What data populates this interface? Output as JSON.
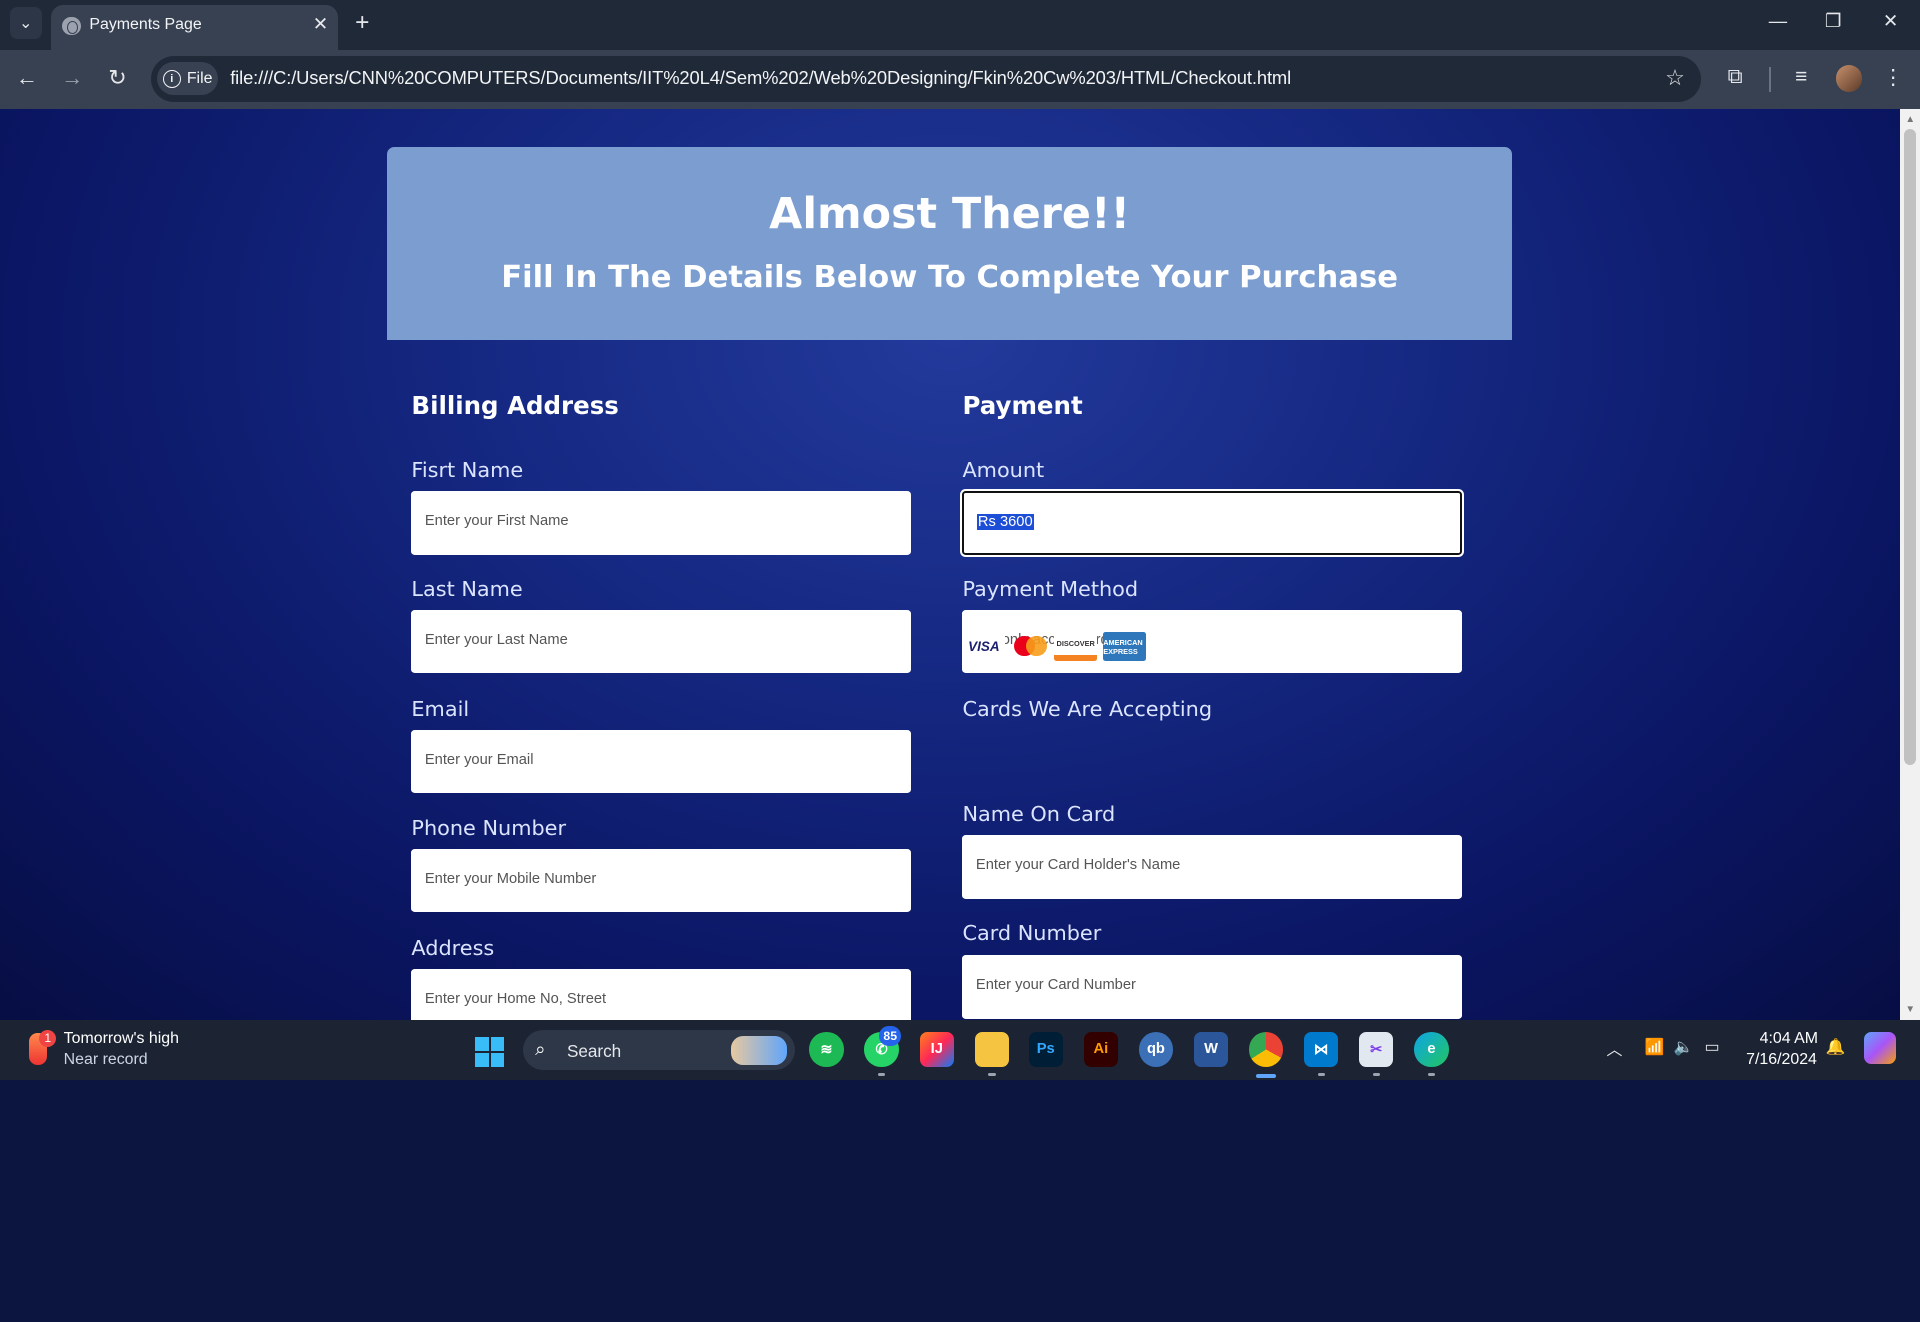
{
  "browser": {
    "tab_title": "Payments Page",
    "new_tab": "+",
    "close_tab": "✕",
    "site_chip": "File",
    "url": "file:///C:/Users/CNN%20COMPUTERS/Documents/IIT%20L4/Sem%202/Web%20Designing/Fkin%20Cw%203/HTML/Checkout.html"
  },
  "hero": {
    "title": "Almost There!!",
    "subtitle": "Fill In The Details Below To Complete Your Purchase"
  },
  "billing": {
    "title": "Billing Address",
    "first_name_label": "Fisrt Name",
    "first_name_placeholder": "Enter your First Name",
    "last_name_label": "Last Name",
    "last_name_placeholder": "Enter your Last Name",
    "email_label": "Email",
    "email_placeholder": "Enter your Email",
    "phone_label": "Phone Number",
    "phone_placeholder": "Enter your Mobile Number",
    "address_label": "Address",
    "address_placeholder": "Enter your Home No, Street"
  },
  "payment": {
    "title": "Payment",
    "amount_label": "Amount",
    "amount_value": "Rs 3600",
    "method_label": "Payment Method",
    "method_placeholder": "We only accept cards",
    "cards_label": "Cards We Are Accepting",
    "cards": [
      "VISA",
      "MasterCard",
      "DISCOVER",
      "AMERICAN EXPRESS"
    ],
    "name_on_card_label": "Name On Card",
    "name_on_card_placeholder": "Enter your Card Holder's Name",
    "card_number_label": "Card Number",
    "card_number_placeholder": "Enter your Card Number"
  },
  "taskbar": {
    "weather_badge": "1",
    "weather_line1": "Tomorrow's high",
    "weather_line2": "Near record",
    "search_label": "Search",
    "whatsapp_badge": "85",
    "time": "4:04 AM",
    "date": "7/16/2024"
  }
}
